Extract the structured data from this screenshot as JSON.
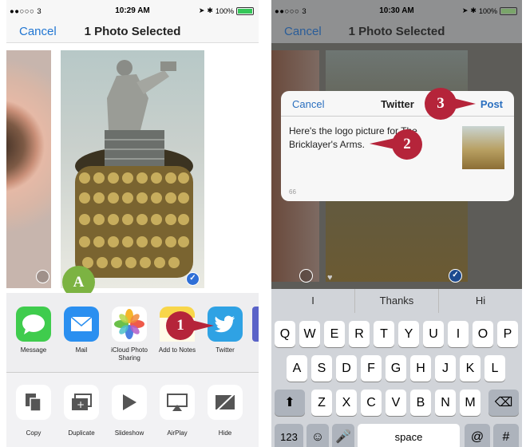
{
  "left": {
    "status": {
      "signal": "●●○○○ 3",
      "time": "10:29 AM",
      "battery": "100%"
    },
    "nav": {
      "cancel": "Cancel",
      "title": "1 Photo Selected"
    },
    "callouts": {
      "a": "A",
      "one": "1"
    },
    "apps": [
      {
        "label": "Message",
        "icon": "messages-icon",
        "color": "#3fcc4d"
      },
      {
        "label": "Mail",
        "icon": "mail-icon",
        "color": "#2a8ff0"
      },
      {
        "label": "iCloud Photo Sharing",
        "icon": "photos-icon",
        "color": "#ffffff"
      },
      {
        "label": "Add to Notes",
        "icon": "notes-icon",
        "color": "#f8d64a"
      },
      {
        "label": "Twitter",
        "icon": "twitter-icon",
        "color": "#2fa2e4"
      }
    ],
    "actions": [
      {
        "label": "Copy",
        "icon": "copy-icon"
      },
      {
        "label": "Duplicate",
        "icon": "duplicate-icon"
      },
      {
        "label": "Slideshow",
        "icon": "slideshow-icon"
      },
      {
        "label": "AirPlay",
        "icon": "airplay-icon"
      },
      {
        "label": "Hide",
        "icon": "hide-icon"
      }
    ]
  },
  "right": {
    "status": {
      "signal": "●●○○○ 3",
      "time": "10:30 AM",
      "battery": "100%"
    },
    "nav": {
      "cancel": "Cancel",
      "title": "1 Photo Selected"
    },
    "dialog": {
      "cancel": "Cancel",
      "title": "Twitter",
      "post": "Post",
      "message": "Here's the logo picture for The Bricklayer's Arms.",
      "count": "66"
    },
    "callouts": {
      "two": "2",
      "three": "3"
    },
    "suggestions": [
      "I",
      "Thanks",
      "Hi"
    ],
    "keys": {
      "row1": [
        "Q",
        "W",
        "E",
        "R",
        "T",
        "Y",
        "U",
        "I",
        "O",
        "P"
      ],
      "row2": [
        "A",
        "S",
        "D",
        "F",
        "G",
        "H",
        "J",
        "K",
        "L"
      ],
      "row3": [
        "Z",
        "X",
        "C",
        "V",
        "B",
        "N",
        "M"
      ],
      "numbers": "123",
      "space": "space",
      "at": "@",
      "hash": "#"
    }
  },
  "colors": {
    "accent": "#2176d2",
    "callout": "#b5243a",
    "callout_a": "#7cb342"
  }
}
